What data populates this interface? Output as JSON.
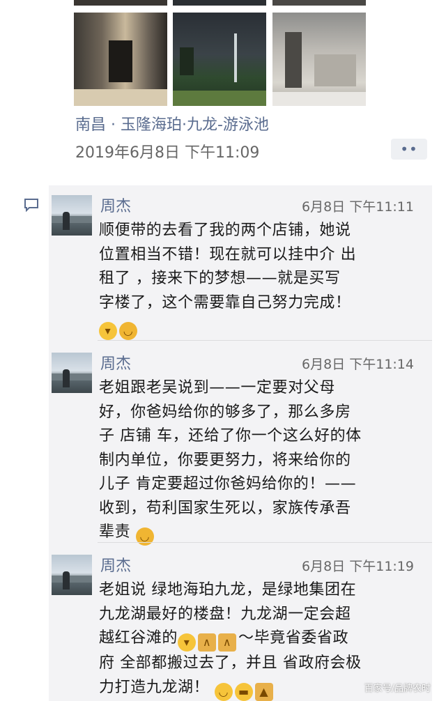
{
  "post": {
    "location": "南昌 · 玉隆海珀·九龙-游泳池",
    "timestamp": "2019年6月8日 下午11:09",
    "more_label": "••"
  },
  "comments": [
    {
      "name": "周杰",
      "time": "6月8日 下午11:11",
      "lines": [
        "顺便带的去看了我的两个店铺，她说",
        "位置相当不错！现在就可以挂中介 出",
        "租了 ，接来下的梦想——就是买写",
        "字楼了，这个需要靠自己努力完成！"
      ],
      "emojis": [
        "grin-emoji",
        "tongue-emoji"
      ]
    },
    {
      "name": "周杰",
      "time": "6月8日 下午11:14",
      "lines": [
        "老姐跟老吴说到——一定要对父母",
        "好，你爸妈给你的够多了，那么多房",
        "子 店铺 车，还给了你一个这么好的体",
        "制内单位，你要更努力，将来给你的",
        "儿子 肯定要超过你爸妈给你的！——",
        "收到，苟利国家生死以，家族传承吾",
        "辈责"
      ]
    },
    {
      "name": "周杰",
      "time": "6月8日 下午11:19",
      "lines": [
        "老姐说 绿地海珀九龙，是绿地集团在",
        "九龙湖最好的楼盘！九龙湖一定会超",
        "越红谷滩的",
        "～毕竟省委省政",
        "府 全部都搬过去了，并且 省政府会极",
        "力打造九龙湖！"
      ]
    }
  ],
  "watermark": "百家号/品牌农时",
  "colors": {
    "name": "#5a6c8f",
    "panel": "#f3f3f5",
    "time": "#666666"
  }
}
